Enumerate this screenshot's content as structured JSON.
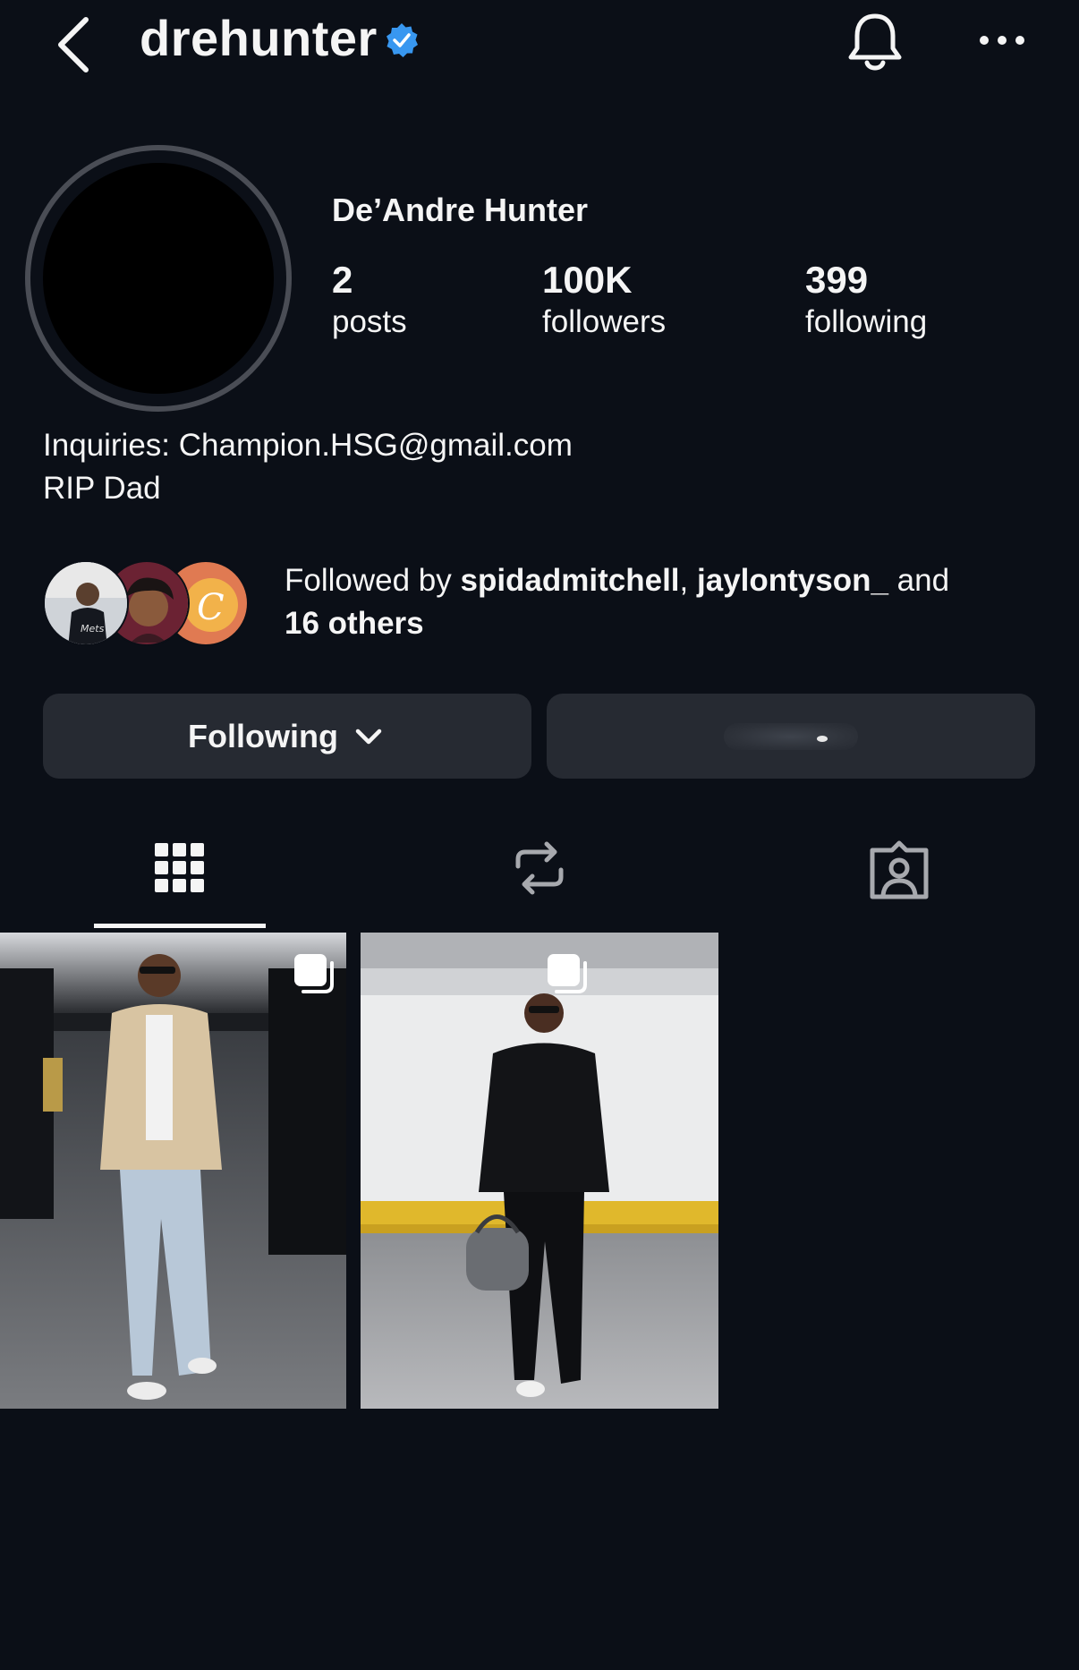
{
  "header": {
    "username": "drehunter",
    "verified_color": "#3897f0"
  },
  "profile": {
    "display_name": "De’Andre Hunter",
    "stats": [
      {
        "number": "2",
        "label": "posts"
      },
      {
        "number": "100K",
        "label": "followers"
      },
      {
        "number": "399",
        "label": "following"
      }
    ],
    "bio_lines": [
      "Inquiries: Champion.HSG@gmail.com",
      "RIP Dad"
    ]
  },
  "followed_by": {
    "prefix": "Followed by ",
    "user1": "spidadmitchell",
    "separator": ", ",
    "user2": "jaylontyson_",
    "conjunction": " and",
    "others": "16 others"
  },
  "actions": {
    "following_label": "Following"
  },
  "tabs": [
    {
      "icon": "grid-icon",
      "active": true
    },
    {
      "icon": "reposts-icon",
      "active": false
    },
    {
      "icon": "tagged-icon",
      "active": false
    }
  ],
  "colors": {
    "background": "#0b0f17",
    "button_bg": "#262a32",
    "text": "#f5f5f5"
  }
}
